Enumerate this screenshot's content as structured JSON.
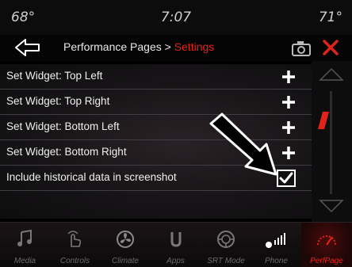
{
  "status": {
    "temp_left": "68°",
    "time": "7:07",
    "temp_right": "71°"
  },
  "header": {
    "breadcrumb_parent": "Performance Pages > ",
    "breadcrumb_current": "Settings"
  },
  "rows": [
    {
      "label": "Set Widget: Top Left"
    },
    {
      "label": "Set Widget: Top Right"
    },
    {
      "label": "Set Widget: Bottom Left"
    },
    {
      "label": "Set Widget: Bottom Right"
    },
    {
      "label": "Include historical data in screenshot",
      "checked": true
    }
  ],
  "dock": [
    {
      "label": "Media",
      "icon": "music-note-icon"
    },
    {
      "label": "Controls",
      "icon": "hand-touch-icon"
    },
    {
      "label": "Climate",
      "icon": "climate-fan-icon"
    },
    {
      "label": "Apps",
      "icon": "apps-icon"
    },
    {
      "label": "SRT Mode",
      "icon": "steering-wheel-icon"
    },
    {
      "label": "Phone",
      "icon": "phone-signal-icon"
    },
    {
      "label": "PerfPage",
      "icon": "performance-gauge-icon",
      "active": true
    }
  ],
  "colors": {
    "accent": "#e2231a",
    "text": "#ffffff",
    "muted": "#6a6a6e"
  }
}
